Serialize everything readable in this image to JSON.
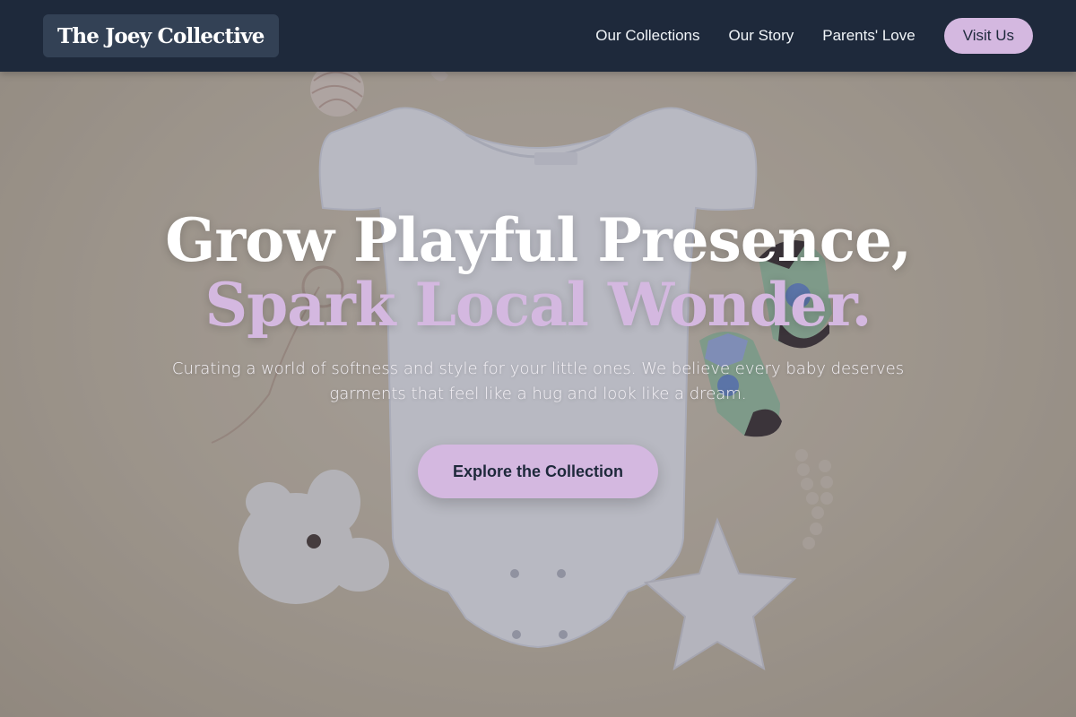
{
  "brand": {
    "name": "The Joey Collective"
  },
  "nav": {
    "links": [
      {
        "label": "Our Collections"
      },
      {
        "label": "Our Story"
      },
      {
        "label": "Parents' Love"
      }
    ],
    "cta_label": "Visit Us"
  },
  "hero": {
    "headline_line1": "Grow Playful Presence,",
    "headline_line2": "Spark Local Wonder.",
    "subtitle": "Curating a world of softness and style for your little ones. We believe every baby deserves garments that feel like a hug and look like a dream.",
    "cta_label": "Explore the Collection",
    "background_description_icon": "baby-onesie-flatlay-image"
  },
  "colors": {
    "navbar": "#1e293b",
    "logo_bg": "#334155",
    "accent": "#d4b8e0",
    "text_light": "#ffffff",
    "text_dark": "#1e293b"
  }
}
